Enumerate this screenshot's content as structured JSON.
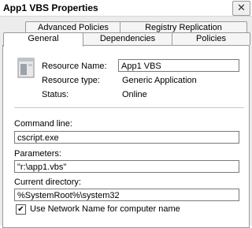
{
  "window": {
    "title": "App1 VBS Properties",
    "close_glyph": "✕"
  },
  "tabs": {
    "row1": [
      "Advanced Policies",
      "Registry Replication"
    ],
    "row2": [
      "General",
      "Dependencies",
      "Policies"
    ],
    "active": "General"
  },
  "general": {
    "resource_name_label": "Resource Name:",
    "resource_name_value": "App1 VBS",
    "resource_type_label": "Resource type:",
    "resource_type_value": "Generic Application",
    "status_label": "Status:",
    "status_value": "Online",
    "command_line_label": "Command line:",
    "command_line_value": "cscript.exe",
    "parameters_label": "Parameters:",
    "parameters_value": "\"r:\\app1.vbs\"",
    "current_directory_label": "Current directory:",
    "current_directory_value": "%SystemRoot%\\system32",
    "use_network_name_label": "Use Network Name for computer name",
    "use_network_name_checked": true,
    "check_glyph": "✔"
  },
  "icons": {
    "resource": "application-window-icon",
    "close": "close-icon"
  }
}
